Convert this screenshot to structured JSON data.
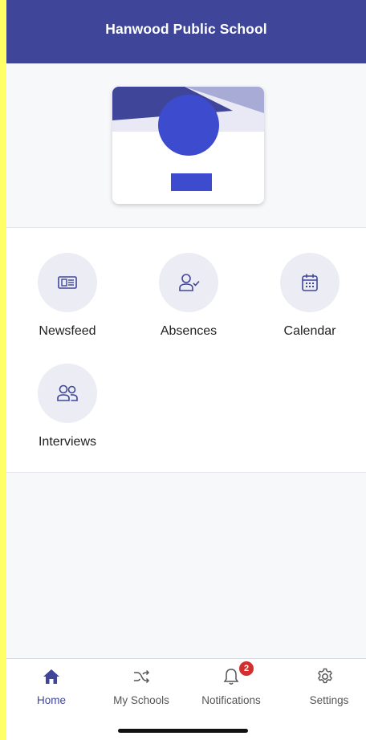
{
  "header": {
    "title": "Hanwood Public School"
  },
  "colors": {
    "brand": "#3f4699",
    "accent": "#3d4ccf",
    "badge": "#d32f2f",
    "side_strip": "#ffff66"
  },
  "tiles": [
    {
      "label": "Newsfeed",
      "icon": "newspaper-icon"
    },
    {
      "label": "Absences",
      "icon": "person-check-icon"
    },
    {
      "label": "Calendar",
      "icon": "calendar-icon"
    },
    {
      "label": "Interviews",
      "icon": "people-icon"
    }
  ],
  "tabbar": {
    "items": [
      {
        "label": "Home",
        "icon": "home-icon",
        "active": true
      },
      {
        "label": "My Schools",
        "icon": "shuffle-icon",
        "active": false
      },
      {
        "label": "Notifications",
        "icon": "bell-icon",
        "active": false,
        "badge": "2"
      },
      {
        "label": "Settings",
        "icon": "gear-icon",
        "active": false
      }
    ]
  }
}
